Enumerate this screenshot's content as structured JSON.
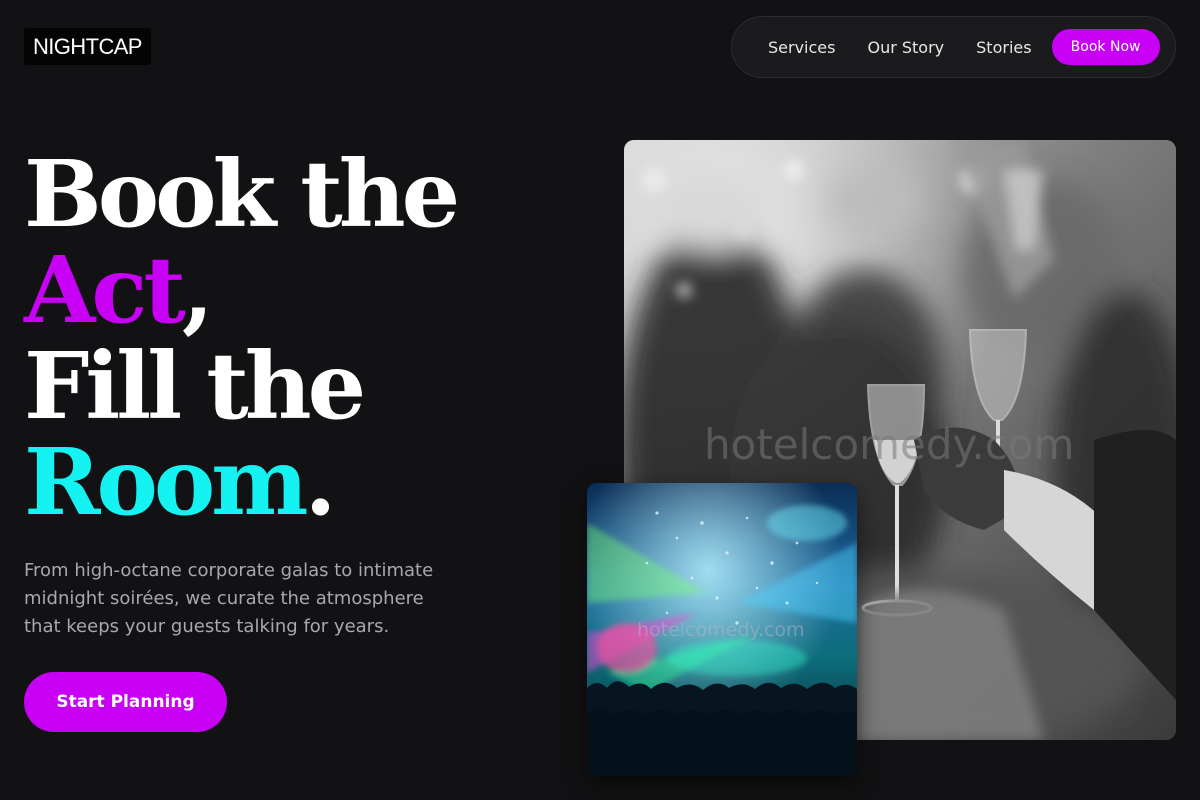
{
  "brand": {
    "logo_text": "NIGHTCAP"
  },
  "nav": {
    "links": [
      "Services",
      "Our Story",
      "Stories"
    ],
    "cta_label": "Book Now"
  },
  "hero": {
    "line1": "Book the",
    "line2_accent": "Act",
    "line2_punct": ",",
    "line3": "Fill the",
    "line4_accent": "Room",
    "line4_punct": ".",
    "subtext": "From high-octane corporate galas to intimate midnight soirées, we curate the atmosphere that keeps your guests talking for years.",
    "cta_label": "Start Planning"
  },
  "images": {
    "main_watermark": "hotelcomedy.com",
    "concert_watermark": "hotelcomedy.com"
  },
  "colors": {
    "background": "#121113",
    "accent_magenta": "#c800f5",
    "accent_cyan": "#15f2f2",
    "subtext": "#a9a9ad"
  }
}
